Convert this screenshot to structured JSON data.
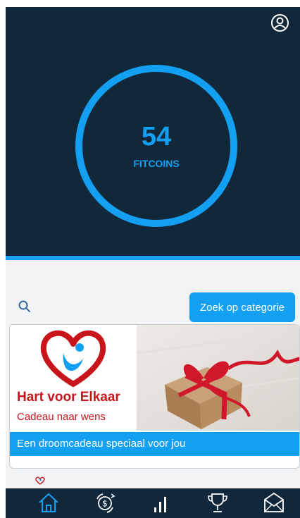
{
  "wallet": {
    "coins": "54",
    "coins_label": "FITCOINS"
  },
  "search": {
    "category_button_label": "Zoek op categorie"
  },
  "offer_card": {
    "logo_title": "Hart voor Elkaar",
    "logo_subtitle": "Cadeau naar wens",
    "caption": "Een droomcadeau speciaal voor jou"
  },
  "tabs": [
    {
      "icon": "home-icon",
      "active": true
    },
    {
      "icon": "coins-exchange-icon",
      "active": false
    },
    {
      "icon": "stats-icon",
      "active": false
    },
    {
      "icon": "trophy-icon",
      "active": false
    },
    {
      "icon": "mail-icon",
      "active": false
    }
  ],
  "colors": {
    "accent": "#13a0f2",
    "dark_background": "#11283a",
    "brand_red": "#c8151b"
  }
}
